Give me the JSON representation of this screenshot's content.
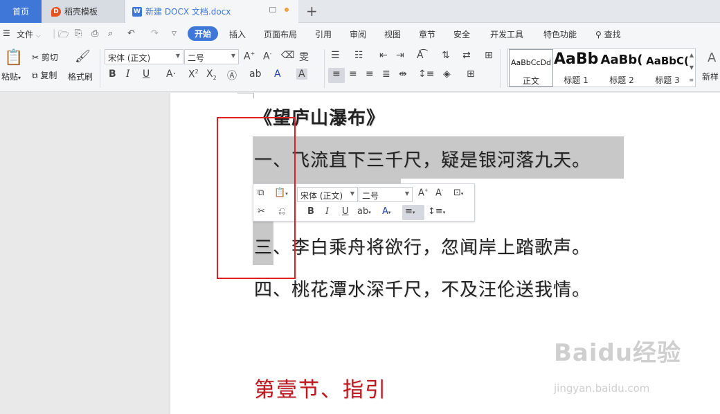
{
  "tabs": {
    "home": "首页",
    "daoke": "稻壳模板",
    "doc": "新建 DOCX 文档.docx",
    "new_tab": "+"
  },
  "menu": {
    "file": "文件",
    "items": [
      "开始",
      "插入",
      "页面布局",
      "引用",
      "审阅",
      "视图",
      "章节",
      "安全",
      "开发工具",
      "特色功能"
    ],
    "search": "查找"
  },
  "ribbon": {
    "paste": "粘贴",
    "cut": "剪切",
    "copy": "复制",
    "format_painter": "格式刷",
    "font_name": "宋体 (正文)",
    "font_size": "二号",
    "styles": [
      {
        "sample": "AaBbCcDd",
        "name": "正文"
      },
      {
        "sample": "AaBb",
        "name": "标题 1"
      },
      {
        "sample": "AaBb(",
        "name": "标题 2"
      },
      {
        "sample": "AaBbC(",
        "name": "标题 3"
      }
    ],
    "new_style": "新样"
  },
  "mini_toolbar": {
    "font_name": "宋体 (正文)",
    "font_size": "二号"
  },
  "document": {
    "title": "《望庐山瀑布》",
    "lines": [
      "一、飞流直下三千尺，疑是银河落九天。",
      "三、李白乘舟将欲行，忽闻岸上踏歌声。",
      "四、桃花潭水深千尺，不及汪伦送我情。"
    ],
    "section_heading": "第壹节、指引"
  },
  "watermark": {
    "logo": "Baidu经验",
    "url": "jingyan.baidu.com"
  },
  "colors": {
    "accent": "#3e77d8",
    "heading_red": "#c0161e",
    "annotation_red": "#e02020",
    "selection": "#c8c8c8"
  }
}
